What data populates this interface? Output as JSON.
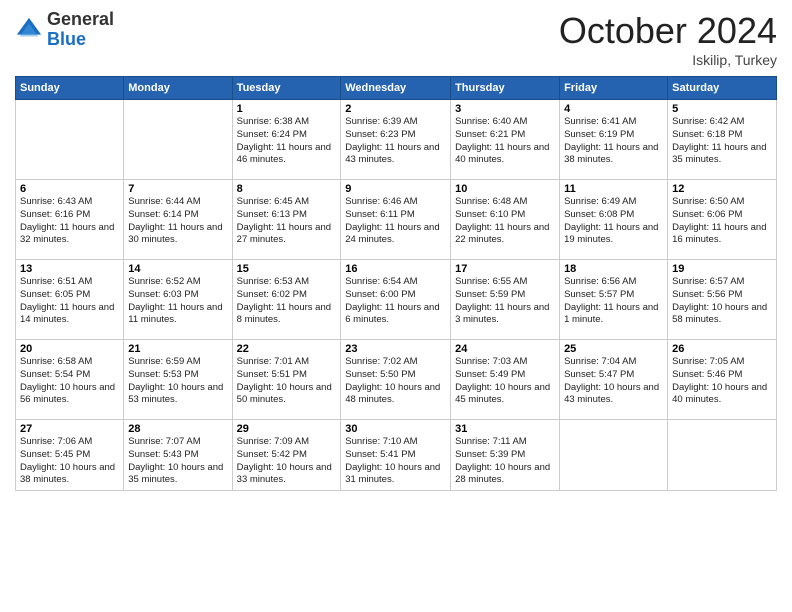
{
  "logo": {
    "general": "General",
    "blue": "Blue"
  },
  "header": {
    "month": "October 2024",
    "location": "Iskilip, Turkey"
  },
  "days_of_week": [
    "Sunday",
    "Monday",
    "Tuesday",
    "Wednesday",
    "Thursday",
    "Friday",
    "Saturday"
  ],
  "weeks": [
    [
      {
        "day": "",
        "sunrise": "",
        "sunset": "",
        "daylight": ""
      },
      {
        "day": "",
        "sunrise": "",
        "sunset": "",
        "daylight": ""
      },
      {
        "day": "1",
        "sunrise": "Sunrise: 6:38 AM",
        "sunset": "Sunset: 6:24 PM",
        "daylight": "Daylight: 11 hours and 46 minutes."
      },
      {
        "day": "2",
        "sunrise": "Sunrise: 6:39 AM",
        "sunset": "Sunset: 6:23 PM",
        "daylight": "Daylight: 11 hours and 43 minutes."
      },
      {
        "day": "3",
        "sunrise": "Sunrise: 6:40 AM",
        "sunset": "Sunset: 6:21 PM",
        "daylight": "Daylight: 11 hours and 40 minutes."
      },
      {
        "day": "4",
        "sunrise": "Sunrise: 6:41 AM",
        "sunset": "Sunset: 6:19 PM",
        "daylight": "Daylight: 11 hours and 38 minutes."
      },
      {
        "day": "5",
        "sunrise": "Sunrise: 6:42 AM",
        "sunset": "Sunset: 6:18 PM",
        "daylight": "Daylight: 11 hours and 35 minutes."
      }
    ],
    [
      {
        "day": "6",
        "sunrise": "Sunrise: 6:43 AM",
        "sunset": "Sunset: 6:16 PM",
        "daylight": "Daylight: 11 hours and 32 minutes."
      },
      {
        "day": "7",
        "sunrise": "Sunrise: 6:44 AM",
        "sunset": "Sunset: 6:14 PM",
        "daylight": "Daylight: 11 hours and 30 minutes."
      },
      {
        "day": "8",
        "sunrise": "Sunrise: 6:45 AM",
        "sunset": "Sunset: 6:13 PM",
        "daylight": "Daylight: 11 hours and 27 minutes."
      },
      {
        "day": "9",
        "sunrise": "Sunrise: 6:46 AM",
        "sunset": "Sunset: 6:11 PM",
        "daylight": "Daylight: 11 hours and 24 minutes."
      },
      {
        "day": "10",
        "sunrise": "Sunrise: 6:48 AM",
        "sunset": "Sunset: 6:10 PM",
        "daylight": "Daylight: 11 hours and 22 minutes."
      },
      {
        "day": "11",
        "sunrise": "Sunrise: 6:49 AM",
        "sunset": "Sunset: 6:08 PM",
        "daylight": "Daylight: 11 hours and 19 minutes."
      },
      {
        "day": "12",
        "sunrise": "Sunrise: 6:50 AM",
        "sunset": "Sunset: 6:06 PM",
        "daylight": "Daylight: 11 hours and 16 minutes."
      }
    ],
    [
      {
        "day": "13",
        "sunrise": "Sunrise: 6:51 AM",
        "sunset": "Sunset: 6:05 PM",
        "daylight": "Daylight: 11 hours and 14 minutes."
      },
      {
        "day": "14",
        "sunrise": "Sunrise: 6:52 AM",
        "sunset": "Sunset: 6:03 PM",
        "daylight": "Daylight: 11 hours and 11 minutes."
      },
      {
        "day": "15",
        "sunrise": "Sunrise: 6:53 AM",
        "sunset": "Sunset: 6:02 PM",
        "daylight": "Daylight: 11 hours and 8 minutes."
      },
      {
        "day": "16",
        "sunrise": "Sunrise: 6:54 AM",
        "sunset": "Sunset: 6:00 PM",
        "daylight": "Daylight: 11 hours and 6 minutes."
      },
      {
        "day": "17",
        "sunrise": "Sunrise: 6:55 AM",
        "sunset": "Sunset: 5:59 PM",
        "daylight": "Daylight: 11 hours and 3 minutes."
      },
      {
        "day": "18",
        "sunrise": "Sunrise: 6:56 AM",
        "sunset": "Sunset: 5:57 PM",
        "daylight": "Daylight: 11 hours and 1 minute."
      },
      {
        "day": "19",
        "sunrise": "Sunrise: 6:57 AM",
        "sunset": "Sunset: 5:56 PM",
        "daylight": "Daylight: 10 hours and 58 minutes."
      }
    ],
    [
      {
        "day": "20",
        "sunrise": "Sunrise: 6:58 AM",
        "sunset": "Sunset: 5:54 PM",
        "daylight": "Daylight: 10 hours and 56 minutes."
      },
      {
        "day": "21",
        "sunrise": "Sunrise: 6:59 AM",
        "sunset": "Sunset: 5:53 PM",
        "daylight": "Daylight: 10 hours and 53 minutes."
      },
      {
        "day": "22",
        "sunrise": "Sunrise: 7:01 AM",
        "sunset": "Sunset: 5:51 PM",
        "daylight": "Daylight: 10 hours and 50 minutes."
      },
      {
        "day": "23",
        "sunrise": "Sunrise: 7:02 AM",
        "sunset": "Sunset: 5:50 PM",
        "daylight": "Daylight: 10 hours and 48 minutes."
      },
      {
        "day": "24",
        "sunrise": "Sunrise: 7:03 AM",
        "sunset": "Sunset: 5:49 PM",
        "daylight": "Daylight: 10 hours and 45 minutes."
      },
      {
        "day": "25",
        "sunrise": "Sunrise: 7:04 AM",
        "sunset": "Sunset: 5:47 PM",
        "daylight": "Daylight: 10 hours and 43 minutes."
      },
      {
        "day": "26",
        "sunrise": "Sunrise: 7:05 AM",
        "sunset": "Sunset: 5:46 PM",
        "daylight": "Daylight: 10 hours and 40 minutes."
      }
    ],
    [
      {
        "day": "27",
        "sunrise": "Sunrise: 7:06 AM",
        "sunset": "Sunset: 5:45 PM",
        "daylight": "Daylight: 10 hours and 38 minutes."
      },
      {
        "day": "28",
        "sunrise": "Sunrise: 7:07 AM",
        "sunset": "Sunset: 5:43 PM",
        "daylight": "Daylight: 10 hours and 35 minutes."
      },
      {
        "day": "29",
        "sunrise": "Sunrise: 7:09 AM",
        "sunset": "Sunset: 5:42 PM",
        "daylight": "Daylight: 10 hours and 33 minutes."
      },
      {
        "day": "30",
        "sunrise": "Sunrise: 7:10 AM",
        "sunset": "Sunset: 5:41 PM",
        "daylight": "Daylight: 10 hours and 31 minutes."
      },
      {
        "day": "31",
        "sunrise": "Sunrise: 7:11 AM",
        "sunset": "Sunset: 5:39 PM",
        "daylight": "Daylight: 10 hours and 28 minutes."
      },
      {
        "day": "",
        "sunrise": "",
        "sunset": "",
        "daylight": ""
      },
      {
        "day": "",
        "sunrise": "",
        "sunset": "",
        "daylight": ""
      }
    ]
  ]
}
